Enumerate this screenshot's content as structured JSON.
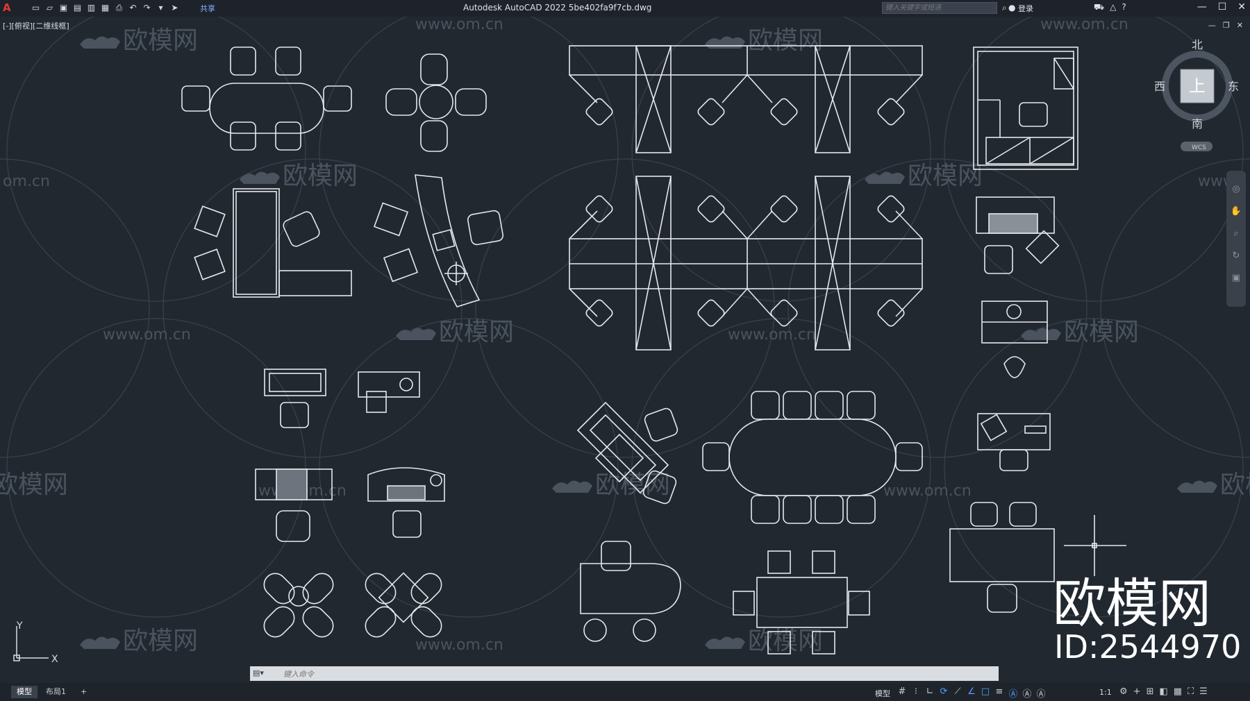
{
  "app": {
    "logo": "A",
    "title": "Autodesk AutoCAD 2022    5be402fa9f7cb.dwg",
    "share_label": "共享",
    "search_placeholder": "键入关键字或短语",
    "login_label": "登录",
    "window_controls": [
      "—",
      "☐",
      "✕"
    ]
  },
  "viewport": {
    "label": "[-][俯视][二维线框]",
    "viewcube": {
      "top": "上",
      "north": "北",
      "south": "南",
      "east": "东",
      "west": "西",
      "wcs": "WCS"
    },
    "ucs": {
      "x": "X",
      "y": "Y"
    }
  },
  "watermarks": {
    "brand": "欧模网",
    "url": "www.om.cn",
    "url_partial": "om.cn",
    "url_partial_right": "www."
  },
  "stamp": {
    "brand": "欧模网",
    "id": "ID:2544970"
  },
  "command_line": {
    "placeholder": "键入命令"
  },
  "status_bar": {
    "tabs": [
      "模型",
      "布局1",
      "+"
    ],
    "model_label": "模型",
    "scale": "1:1"
  },
  "colors": {
    "background": "#212830",
    "line": "#e6e9ec",
    "watermark": "#3c444f"
  }
}
